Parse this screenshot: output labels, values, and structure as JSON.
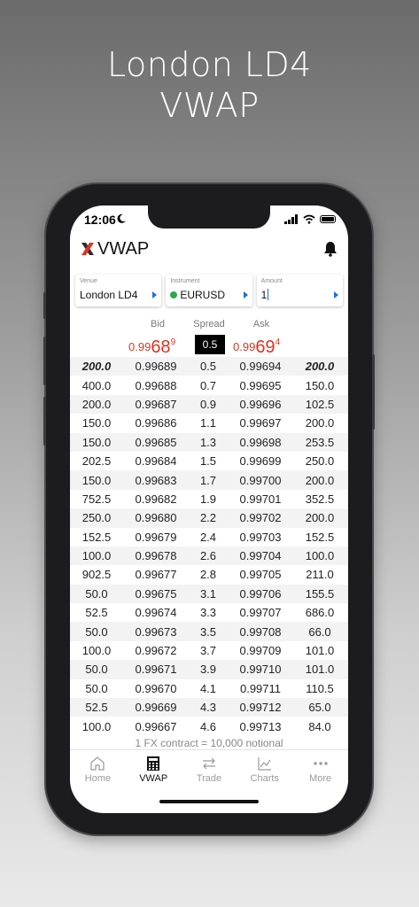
{
  "promo": {
    "line1": "London LD4",
    "line2": "VWAP"
  },
  "status": {
    "time": "12:06"
  },
  "app": {
    "title": "VWAP"
  },
  "selectors": {
    "venue": {
      "label": "Venue",
      "value": "London LD4"
    },
    "instrument": {
      "label": "Instrument",
      "value": "EURUSD"
    },
    "amount": {
      "label": "Amount",
      "value": "1"
    }
  },
  "headers": {
    "bid": "Bid",
    "spread": "Spread",
    "ask": "Ask"
  },
  "best": {
    "bid_prefix": "0.99",
    "bid_big": "68",
    "bid_sup": "9",
    "spread": "0.5",
    "ask_prefix": "0.99",
    "ask_big": "69",
    "ask_sup": "4"
  },
  "ladder": [
    {
      "bid_qty": "200.0",
      "bid": "0.99689",
      "spread": "0.5",
      "ask": "0.99694",
      "ask_qty": "200.0"
    },
    {
      "bid_qty": "400.0",
      "bid": "0.99688",
      "spread": "0.7",
      "ask": "0.99695",
      "ask_qty": "150.0"
    },
    {
      "bid_qty": "200.0",
      "bid": "0.99687",
      "spread": "0.9",
      "ask": "0.99696",
      "ask_qty": "102.5"
    },
    {
      "bid_qty": "150.0",
      "bid": "0.99686",
      "spread": "1.1",
      "ask": "0.99697",
      "ask_qty": "200.0"
    },
    {
      "bid_qty": "150.0",
      "bid": "0.99685",
      "spread": "1.3",
      "ask": "0.99698",
      "ask_qty": "253.5"
    },
    {
      "bid_qty": "202.5",
      "bid": "0.99684",
      "spread": "1.5",
      "ask": "0.99699",
      "ask_qty": "250.0"
    },
    {
      "bid_qty": "150.0",
      "bid": "0.99683",
      "spread": "1.7",
      "ask": "0.99700",
      "ask_qty": "200.0"
    },
    {
      "bid_qty": "752.5",
      "bid": "0.99682",
      "spread": "1.9",
      "ask": "0.99701",
      "ask_qty": "352.5"
    },
    {
      "bid_qty": "250.0",
      "bid": "0.99680",
      "spread": "2.2",
      "ask": "0.99702",
      "ask_qty": "200.0"
    },
    {
      "bid_qty": "152.5",
      "bid": "0.99679",
      "spread": "2.4",
      "ask": "0.99703",
      "ask_qty": "152.5"
    },
    {
      "bid_qty": "100.0",
      "bid": "0.99678",
      "spread": "2.6",
      "ask": "0.99704",
      "ask_qty": "100.0"
    },
    {
      "bid_qty": "902.5",
      "bid": "0.99677",
      "spread": "2.8",
      "ask": "0.99705",
      "ask_qty": "211.0"
    },
    {
      "bid_qty": "50.0",
      "bid": "0.99675",
      "spread": "3.1",
      "ask": "0.99706",
      "ask_qty": "155.5"
    },
    {
      "bid_qty": "52.5",
      "bid": "0.99674",
      "spread": "3.3",
      "ask": "0.99707",
      "ask_qty": "686.0"
    },
    {
      "bid_qty": "50.0",
      "bid": "0.99673",
      "spread": "3.5",
      "ask": "0.99708",
      "ask_qty": "66.0"
    },
    {
      "bid_qty": "100.0",
      "bid": "0.99672",
      "spread": "3.7",
      "ask": "0.99709",
      "ask_qty": "101.0"
    },
    {
      "bid_qty": "50.0",
      "bid": "0.99671",
      "spread": "3.9",
      "ask": "0.99710",
      "ask_qty": "101.0"
    },
    {
      "bid_qty": "50.0",
      "bid": "0.99670",
      "spread": "4.1",
      "ask": "0.99711",
      "ask_qty": "110.5"
    },
    {
      "bid_qty": "52.5",
      "bid": "0.99669",
      "spread": "4.3",
      "ask": "0.99712",
      "ask_qty": "65.0"
    },
    {
      "bid_qty": "100.0",
      "bid": "0.99667",
      "spread": "4.6",
      "ask": "0.99713",
      "ask_qty": "84.0"
    }
  ],
  "footnote": "1 FX contract = 10,000 notional",
  "tabs": [
    {
      "label": "Home",
      "icon": "home-icon"
    },
    {
      "label": "VWAP",
      "icon": "calculator-icon"
    },
    {
      "label": "Trade",
      "icon": "swap-arrows-icon"
    },
    {
      "label": "Charts",
      "icon": "line-chart-icon"
    },
    {
      "label": "More",
      "icon": "more-dots-icon"
    }
  ],
  "colors": {
    "price_red": "#e0321e",
    "accent_blue": "#1a6fe0",
    "status_green": "#2ea84f"
  }
}
